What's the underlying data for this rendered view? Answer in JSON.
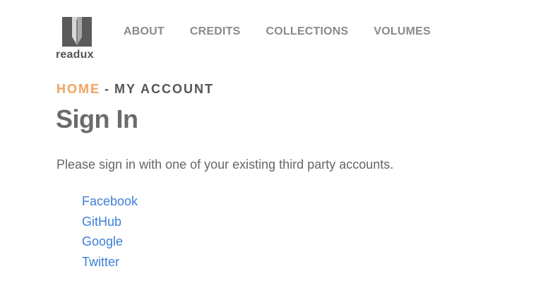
{
  "logo": {
    "text": "readux"
  },
  "nav": {
    "items": [
      {
        "label": "ABOUT"
      },
      {
        "label": "CREDITS"
      },
      {
        "label": "COLLECTIONS"
      },
      {
        "label": "VOLUMES"
      }
    ]
  },
  "breadcrumb": {
    "home": "HOME",
    "separator": "-",
    "current": "MY ACCOUNT"
  },
  "page": {
    "title": "Sign In",
    "intro": "Please sign in with one of your existing third party accounts."
  },
  "providers": [
    {
      "label": "Facebook"
    },
    {
      "label": "GitHub"
    },
    {
      "label": "Google"
    },
    {
      "label": "Twitter"
    }
  ],
  "colors": {
    "accent": "#f0a35e",
    "link": "#3d7fd9",
    "nav": "#8a8a8a",
    "heading": "#6b6b6b"
  }
}
